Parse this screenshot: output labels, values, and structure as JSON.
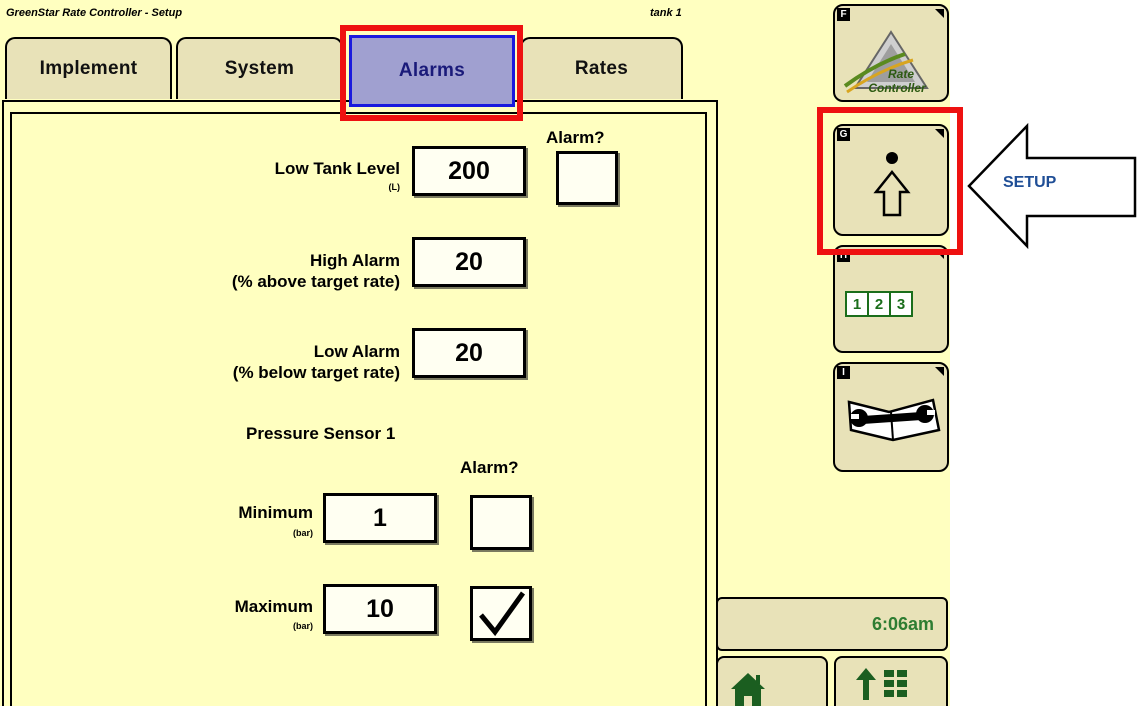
{
  "header": {
    "title": "GreenStar Rate Controller - Setup",
    "tank": "tank 1"
  },
  "tabs": [
    {
      "label": "Implement",
      "active": false
    },
    {
      "label": "System",
      "active": false
    },
    {
      "label": "Alarms",
      "active": true
    },
    {
      "label": "Rates",
      "active": false
    }
  ],
  "alarm_header_top": "Alarm?",
  "low_tank": {
    "label": "Low Tank Level",
    "unit": "(L)",
    "value": "200",
    "alarm_checked": false
  },
  "high_alarm": {
    "label_line1": "High Alarm",
    "label_line2": "(% above target rate)",
    "value": "20"
  },
  "low_alarm": {
    "label_line1": "Low Alarm",
    "label_line2": "(% below target rate)",
    "value": "20"
  },
  "pressure": {
    "title": "Pressure Sensor 1",
    "alarm_header": "Alarm?",
    "minimum": {
      "label": "Minimum",
      "unit": "(bar)",
      "value": "1",
      "alarm_checked": false
    },
    "maximum": {
      "label": "Maximum",
      "unit": "(bar)",
      "value": "10",
      "alarm_checked": true
    }
  },
  "softkeys": [
    {
      "letter": "F",
      "icon": "rate-controller-icon",
      "icon_text_1": "Rate",
      "icon_text_2": "Controller"
    },
    {
      "letter": "G",
      "icon": "setup-person-arrow-icon"
    },
    {
      "letter": "H",
      "icon": "numeric-123-icon",
      "digits": [
        "1",
        "2",
        "3"
      ]
    },
    {
      "letter": "I",
      "icon": "wrench-book-icon"
    }
  ],
  "clock": "6:06am",
  "annotation": {
    "setup_label": "SETUP",
    "highlight_color": "#ee1111",
    "arrow_text_color": "#1f4e96"
  },
  "colors": {
    "screen_bg": "#ffffc0",
    "button_bg": "#e8e2b8",
    "active_tab_bg": "#a0a0d0",
    "clock_text": "#2e7d32"
  }
}
